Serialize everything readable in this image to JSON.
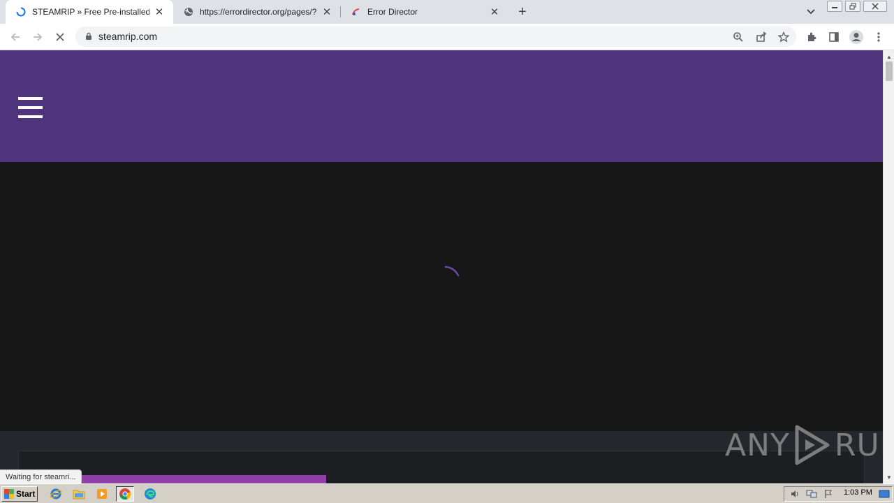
{
  "browser": {
    "tabs": [
      {
        "title": "STEAMRIP » Free Pre-installed Steam",
        "active": true,
        "icon": "loading-spinner-icon"
      },
      {
        "title": "https://errordirector.org/pages/?a=",
        "active": false,
        "icon": "globe-icon"
      },
      {
        "title": "Error Director",
        "active": false,
        "icon": "error-director-favicon"
      }
    ],
    "new_tab_label": "+",
    "url": "steamrip.com",
    "status_text": "Waiting for steamri..."
  },
  "page": {
    "header_color": "#4d347c",
    "body_color": "#171717",
    "accent_color": "#8f3fa6"
  },
  "watermark": {
    "left": "ANY",
    "right": "RUN"
  },
  "taskbar": {
    "start_label": "Start",
    "clock": "1:03 PM",
    "apps": [
      "internet-explorer-icon",
      "folder-icon",
      "media-player-icon",
      "chrome-icon",
      "edge-icon"
    ]
  }
}
